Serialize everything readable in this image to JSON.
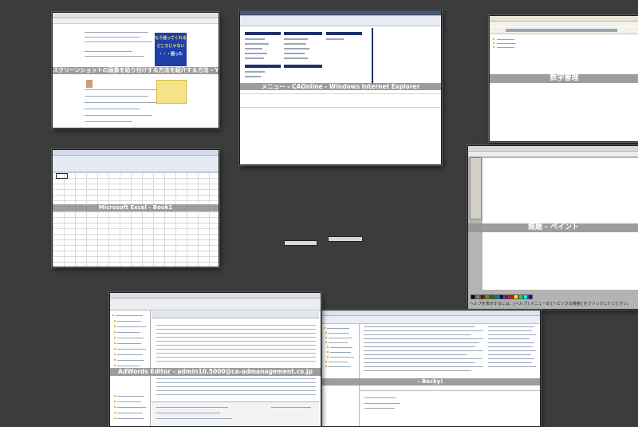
{
  "windows": {
    "chrome": {
      "caption": "スクリーンショットの画像を貼り付けする方法を紹介する方法 - Yahoo!知恵袋 - Google Chrome",
      "ad_text_1": "もう迷ってくれる",
      "ad_text_2": "どころじゃない",
      "ad_text_3": "・・・困った"
    },
    "ie": {
      "caption": "メニュー - CAOnline - Windows Internet Explorer"
    },
    "folder": {
      "caption": "数字管理"
    },
    "excel": {
      "caption": "Microsoft Excel - Book1"
    },
    "paint": {
      "caption": "無題 - ペイント",
      "statusbar": "ヘルプを表示するには、[ヘルプ] メニューの [トピックの検索] をクリックしてください。"
    },
    "adwords": {
      "caption": "AdWords Editor - admin10.5000@ca-admanagement.co.jp"
    },
    "becky": {
      "caption": "- Becky!"
    }
  }
}
